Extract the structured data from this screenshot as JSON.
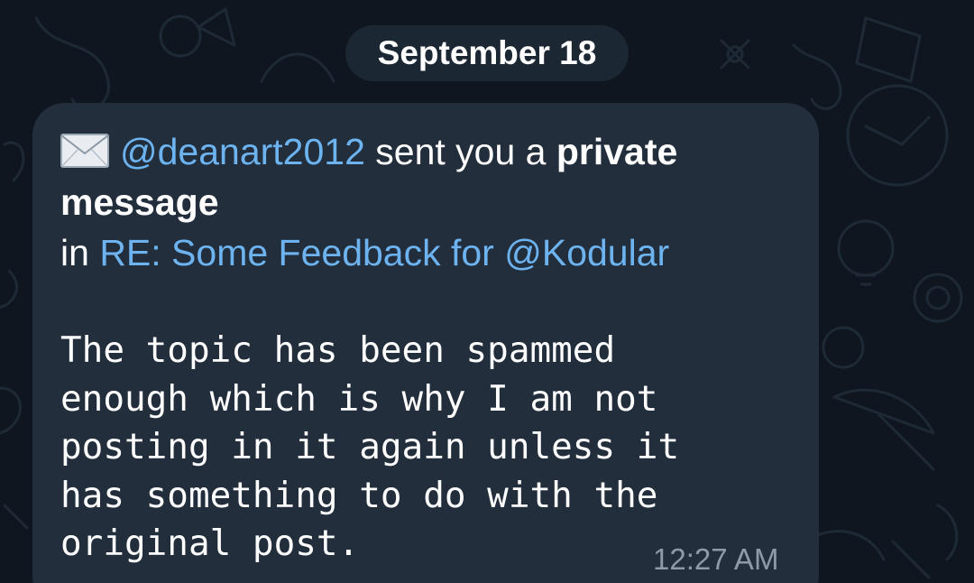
{
  "date_separator": "September 18",
  "message": {
    "sender": "@deanart2012",
    "text_sent": " sent you a ",
    "text_private": "private",
    "text_message": "message",
    "text_in": "in ",
    "topic_link": "RE: Some Feedback for @Kodular",
    "body_lines": [
      "The topic has been spammed",
      "enough which is why I am not",
      "posting in it again unless it",
      "has something to do with the",
      "original post."
    ],
    "time": "12:27 AM"
  },
  "icons": {
    "envelope": "envelope-icon"
  },
  "colors": {
    "background": "#0f1620",
    "bubble": "#222e3c",
    "date_pill": "#1c2734",
    "link": "#6db3ef",
    "timestamp": "#8e9aa7"
  }
}
